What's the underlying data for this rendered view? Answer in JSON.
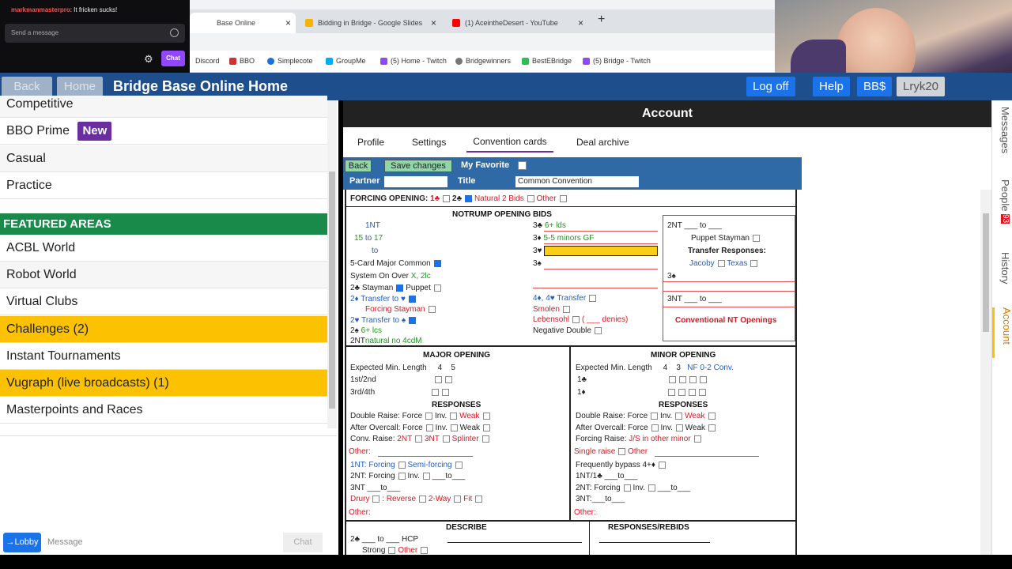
{
  "twitch": {
    "message_user": "markmanmasterpro",
    "message_text": ": It fricken sucks!",
    "send_placeholder": "Send a message",
    "chat_btn": "Chat"
  },
  "tabs": [
    {
      "label": "Base Online",
      "close": "×"
    },
    {
      "label": "Bidding in Bridge - Google Slides",
      "close": "×"
    },
    {
      "label": "(1) AceintheDesert - YouTube",
      "close": "×"
    }
  ],
  "new_tab": "+",
  "bookmarks": [
    "Discord",
    "BBO",
    "Simplecote",
    "GroupMe",
    "(5) Home - Twitch",
    "Bridgewinners",
    "BestEBridge",
    "(5) Bridge - Twitch"
  ],
  "header": {
    "back": "Back",
    "home": "Home",
    "title": "Bridge Base Online Home",
    "logoff": "Log off",
    "help": "Help",
    "bb": "BB$",
    "user": "Lryk20"
  },
  "left_nav": {
    "items_top": [
      "Competitive",
      "BBO Prime",
      "Casual",
      "Practice"
    ],
    "new_badge": "New",
    "featured_heading": "FEATURED AREAS",
    "featured": [
      "ACBL World",
      "Robot World",
      "Virtual Clubs",
      "Challenges (2)",
      "Instant Tournaments",
      "Vugraph (live broadcasts) (1)",
      "Masterpoints and Races"
    ],
    "lobby_btn": "→Lobby",
    "message_placeholder": "Message",
    "chat_btn": "Chat"
  },
  "account": {
    "title": "Account",
    "tabs": [
      "Profile",
      "Settings",
      "Convention cards",
      "Deal archive"
    ],
    "toolbar": {
      "back": "Back",
      "save": "Save changes",
      "favorite": "My Favorite",
      "partner": "Partner",
      "title_label": "Title",
      "title_value": "Common Convention"
    }
  },
  "card": {
    "forcing": "FORCING OPENING:",
    "forcing_1c": "1♣",
    "forcing_2c": "2♣",
    "natural2": "Natural 2 Bids",
    "other": "Other",
    "nt_heading": "NOTRUMP OPENING BIDS",
    "nt1": "1NT",
    "nt_range_a": "15",
    "nt_to": "to",
    "nt_range_b": "17",
    "nt_to2": "to",
    "five_card": "5-Card Major Common",
    "system_on": "System On Over",
    "system_val": "X, 2lc",
    "stayman": "2♣  Stayman",
    "puppet": "Puppet",
    "transfer_h": "2♦  Transfer to ♥",
    "forcing_stayman": "Forcing Stayman",
    "transfer_s": "2♥  Transfer to ♠",
    "twos": "2♠",
    "twos_val": "6+ lcs",
    "two_nt": "2NT",
    "two_nt_val": "natural no 4cdM",
    "r3c": "3♣",
    "r3c_val": "6+ lds",
    "r3d": "3♦",
    "r3d_val": "5-5 minors GF",
    "r3h": "3♥",
    "r3s": "3♠",
    "four_d": "4♦, 4♥ Transfer",
    "smolen": "Smolen",
    "lebensohl": "Lebensohl",
    "denies": "( ___ denies)",
    "negdbl": "Negative Double",
    "nt2": "2NT",
    "nt2_to": "to",
    "puppet_stayman": "Puppet Stayman",
    "transfer_resp": "Transfer Responses:",
    "jacoby": "Jacoby",
    "texas": "Texas",
    "r3s_b": "3♠",
    "nt3": "3NT",
    "nt3_to": "to",
    "conv_nt": "Conventional NT Openings",
    "major_heading": "MAJOR OPENING",
    "minor_heading": "MINOR OPENING",
    "exp_len": "Expected Min. Length",
    "len4": "4",
    "len5": "5",
    "len3": "3",
    "nf02": "NF 0-2 Conv.",
    "first2": "1st/2nd",
    "third4": "3rd/4th",
    "oneC": "1♣",
    "oneD": "1♦",
    "responses": "RESPONSES",
    "dbl_raise": "Double Raise: Force",
    "inv": "Inv.",
    "weak": "Weak",
    "after_oc": "After Overcall: Force",
    "conv_raise": "Conv. Raise:",
    "twoNT": "2NT",
    "threeNT": "3NT",
    "splinter": "Splinter",
    "forcing_raise": "Forcing Raise:",
    "js_minor": "J/S in other minor",
    "other_lbl": "Other:",
    "single_raise": "Single raise",
    "other2": "Other",
    "nt1_forcing": "1NT: Forcing",
    "semi": "Semi-forcing",
    "freq_bypass": "Frequently bypass 4+♦",
    "nt2_forcing": "2NT: Forcing",
    "nt1_1c": "1NT/1♣",
    "to_lbl": "to",
    "nt3_lbl": "3NT:",
    "drury": "Drury",
    "reverse": ": Reverse",
    "twoway": "2-Way",
    "fit": "Fit",
    "describe": "DESCRIBE",
    "resp_rebids": "RESPONSES/REBIDS",
    "two_c_hcp": "2♣",
    "hcp": "HCP",
    "strong": "Strong"
  },
  "side_tabs": [
    "Messages",
    "People",
    "History",
    "Account"
  ],
  "people_count": "93"
}
